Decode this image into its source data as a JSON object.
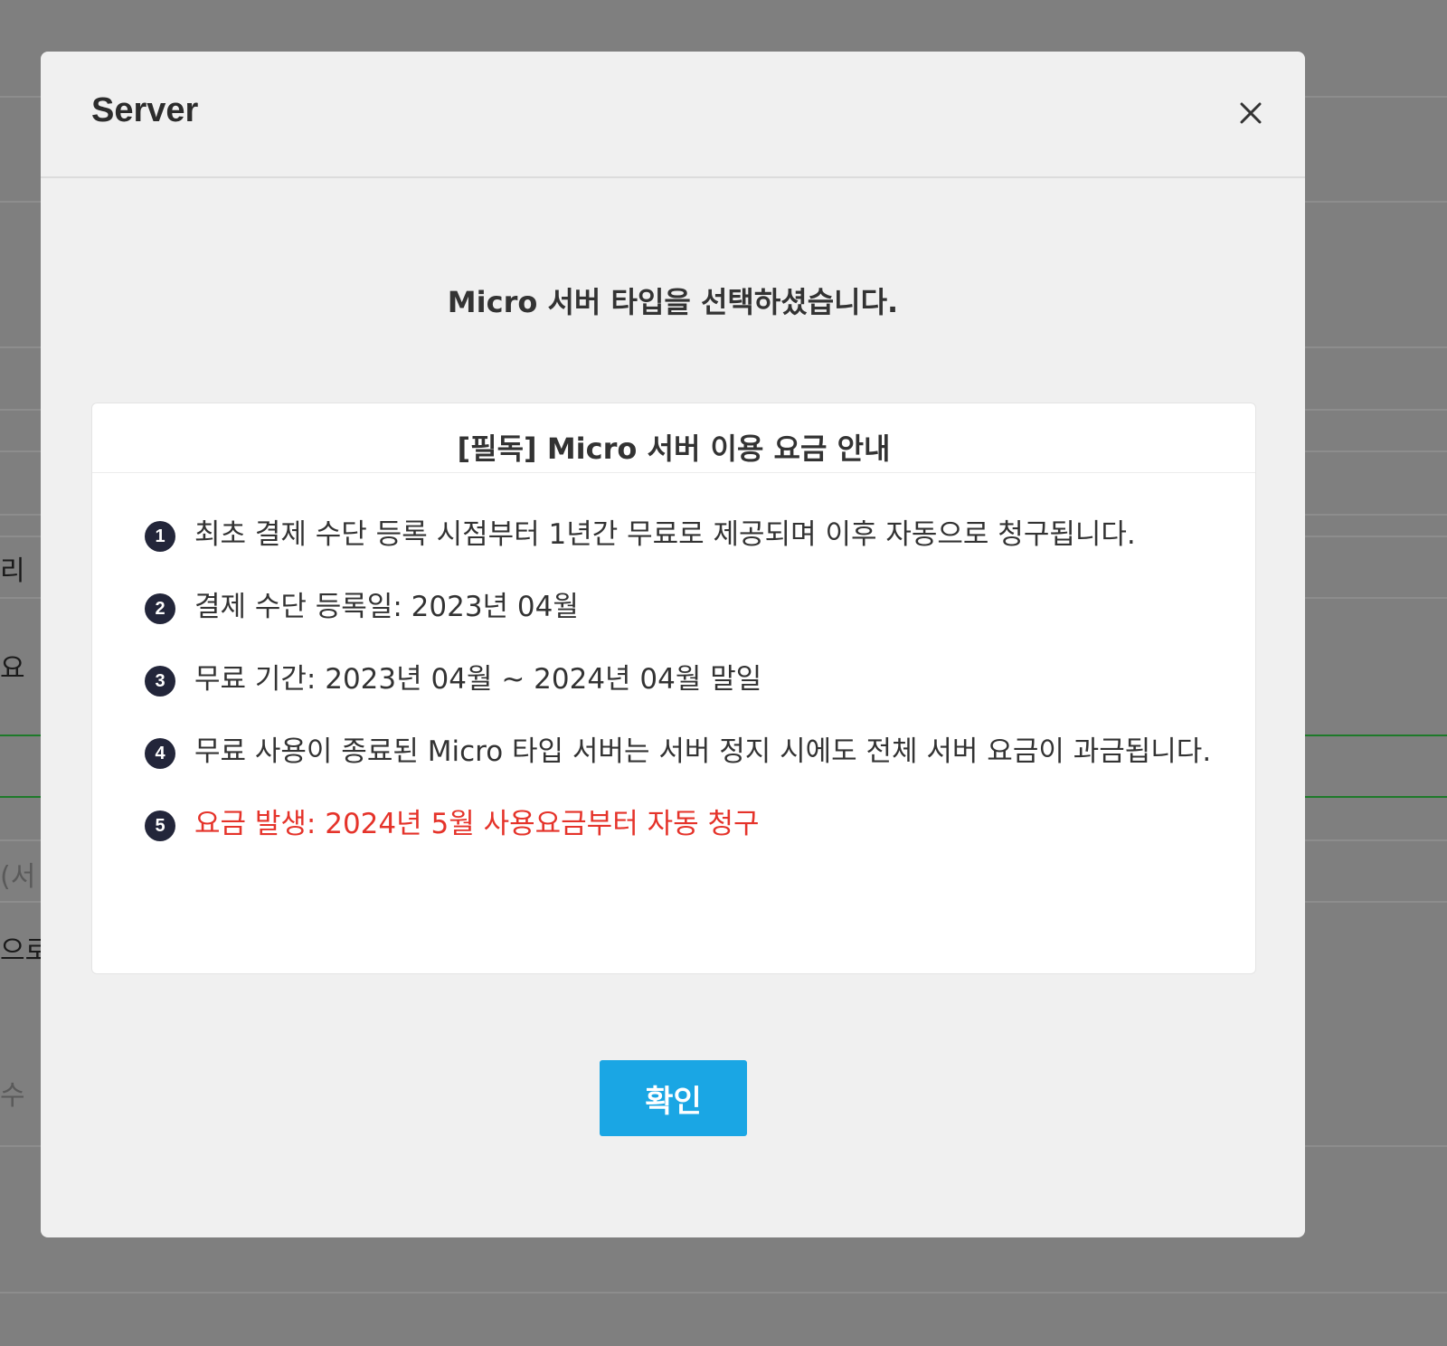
{
  "background": {
    "fragments": [
      "리",
      "요",
      "(서",
      "으로",
      "수"
    ]
  },
  "dialog": {
    "title": "Server",
    "close_icon": "close-icon",
    "message": "Micro 서버 타입을 선택하셨습니다.",
    "notice": {
      "title": "[필독] Micro 서버 이용 요금 안내",
      "items": [
        {
          "num": "1",
          "text": "최초 결제 수단 등록 시점부터 1년간 무료로 제공되며 이후 자동으로 청구됩니다."
        },
        {
          "num": "2",
          "text": "결제 수단 등록일: 2023년 04월"
        },
        {
          "num": "3",
          "text": "무료 기간: 2023년 04월 ~ 2024년 04월 말일"
        },
        {
          "num": "4",
          "text": "무료 사용이 종료된 Micro 타입 서버는 서버 정지 시에도 전체 서버 요금이 과금됩니다."
        },
        {
          "num": "5",
          "text": "요금 발생: 2024년 5월 사용요금부터 자동 청구",
          "highlight_color": "#e5332a"
        }
      ]
    },
    "confirm_label": "확인"
  },
  "colors": {
    "overlay": "#7f7f7f",
    "modal_bg": "#f0f0f0",
    "primary_button": "#1aa6e4",
    "warning_text": "#e5332a"
  }
}
